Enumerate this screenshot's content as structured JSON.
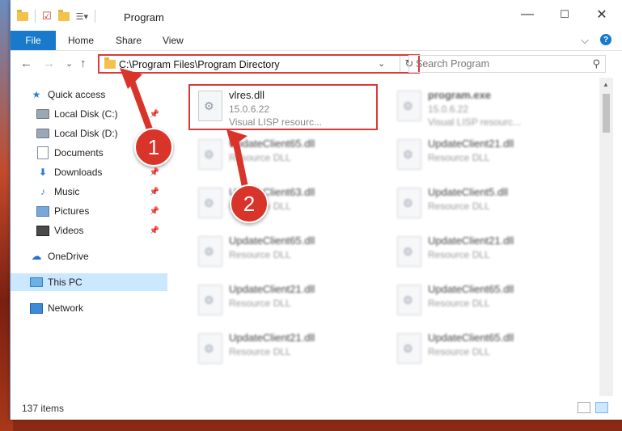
{
  "window": {
    "title": "Program",
    "controls": {
      "minimize": "—",
      "maximize": "☐",
      "close": "✕"
    }
  },
  "ribbon": {
    "file": "File",
    "tabs": [
      "Home",
      "Share",
      "View"
    ],
    "expand": "⌵",
    "help": "?"
  },
  "nav": {
    "back": "←",
    "forward": "→",
    "recent": "⌄",
    "up": "↑",
    "address": "C:\\Program Files\\Program Directory",
    "address_dropdown": "⌄",
    "refresh": "↻",
    "search_placeholder": "Search Program",
    "search_icon": "⚲"
  },
  "sidebar": {
    "items": [
      {
        "label": "Quick access",
        "icon": "star-icon"
      },
      {
        "label": "Local Disk (C:)",
        "icon": "disk-icon"
      },
      {
        "label": "Local Disk (D:)",
        "icon": "disk-icon"
      },
      {
        "label": "Documents",
        "icon": "document-icon"
      },
      {
        "label": "Downloads",
        "icon": "download-icon"
      },
      {
        "label": "Music",
        "icon": "music-icon"
      },
      {
        "label": "Pictures",
        "icon": "pictures-icon"
      },
      {
        "label": "Videos",
        "icon": "videos-icon"
      },
      {
        "label": "OneDrive",
        "icon": "cloud-icon"
      },
      {
        "label": "This PC",
        "icon": "computer-icon"
      },
      {
        "label": "Network",
        "icon": "network-icon"
      }
    ]
  },
  "files": [
    {
      "name": "vlres.dll",
      "version": "15.0.6.22",
      "desc": "Visual LISP resourc..."
    },
    {
      "name": "program.exe",
      "version": "15.0.6.22",
      "desc": "Visual LISP resourc..."
    },
    {
      "name": "UpdateClient65.dll",
      "desc": "Resource DLL"
    },
    {
      "name": "UpdateClient21.dll",
      "desc": "Resource DLL"
    },
    {
      "name": "UpdateClient63.dll",
      "desc": "Resource DLL"
    },
    {
      "name": "UpdateClient5.dll",
      "desc": "Resource DLL"
    },
    {
      "name": "UpdateClient65.dll",
      "desc": "Resource DLL"
    },
    {
      "name": "UpdateClient21.dll",
      "desc": "Resource DLL"
    },
    {
      "name": "UpdateClient21.dll",
      "desc": "Resource DLL"
    },
    {
      "name": "UpdateClient65.dll",
      "desc": "Resource DLL"
    },
    {
      "name": "UpdateClient21.dll",
      "desc": "Resource DLL"
    },
    {
      "name": "UpdateClient65.dll",
      "desc": "Resource DLL"
    }
  ],
  "status": {
    "count": "137 items"
  },
  "annotations": {
    "step1": "1",
    "step2": "2",
    "color": "#d9342a"
  }
}
